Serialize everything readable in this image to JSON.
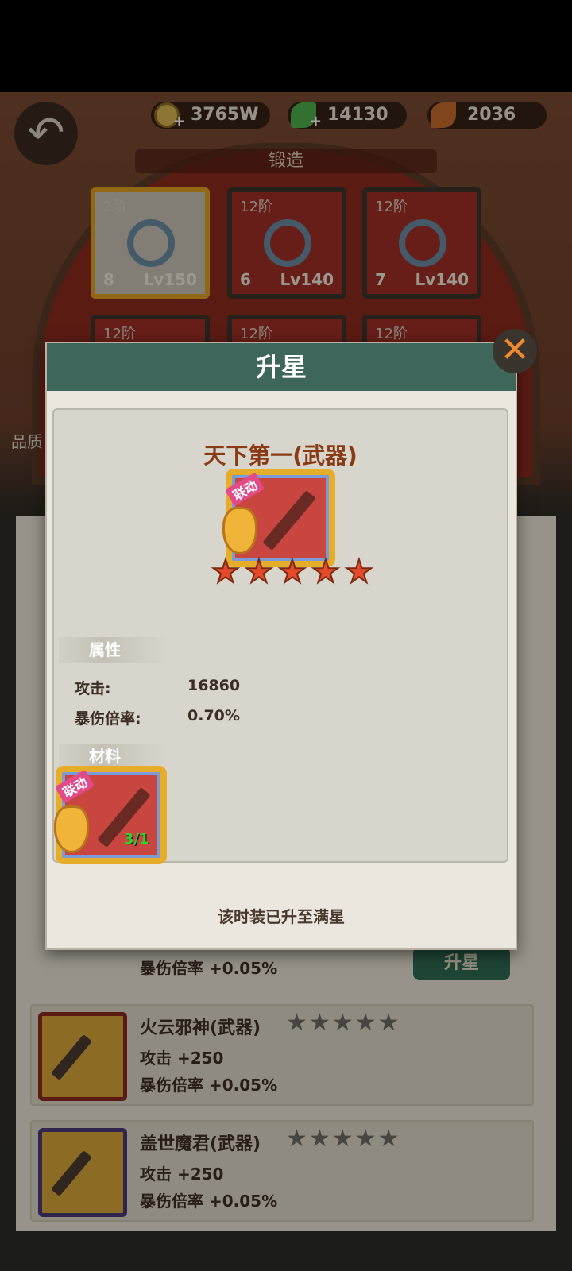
{
  "resources": {
    "gold": "3765W",
    "leaf": "14130",
    "feather": "2036",
    "plus": "+"
  },
  "forge": {
    "title": "锻造",
    "back_icon": "back-arrow-icon",
    "tiles": [
      {
        "tier": "2阶",
        "count": "8",
        "level": "Lv150"
      },
      {
        "tier": "12阶",
        "count": "6",
        "level": "Lv140"
      },
      {
        "tier": "12阶",
        "count": "7",
        "level": "Lv140"
      },
      {
        "tier": "12阶"
      },
      {
        "tier": "12阶"
      },
      {
        "tier": "12阶"
      }
    ],
    "quality_label": "品质"
  },
  "list": {
    "upstar_button": "升星",
    "partial_row_stat": "暴伤倍率 +0.05%",
    "rows": [
      {
        "name": "火云邪神(武器)",
        "stat1": "攻击 +250",
        "stat2": "暴伤倍率 +0.05%",
        "stars": "★★★★★"
      },
      {
        "name": "盖世魔君(武器)",
        "stat1": "攻击 +250",
        "stat2": "暴伤倍率 +0.05%",
        "stars": "★★★★★"
      }
    ]
  },
  "modal": {
    "title": "升星",
    "close_icon": "close-x-icon",
    "item_name": "天下第一(武器)",
    "collab_tag": "联动",
    "star_count": 5,
    "attributes_label": "属性",
    "attributes": [
      {
        "label": "攻击:",
        "value": "16860"
      },
      {
        "label": "暴伤倍率:",
        "value": "0.70%"
      }
    ],
    "materials_label": "材料",
    "material_count": "3/1",
    "footer_note": "该时装已升至满星"
  },
  "colors": {
    "header_green": "#3e665a",
    "star_red": "#e54a2a",
    "name_brown": "#8a3a14",
    "count_green": "#2fd22f"
  }
}
